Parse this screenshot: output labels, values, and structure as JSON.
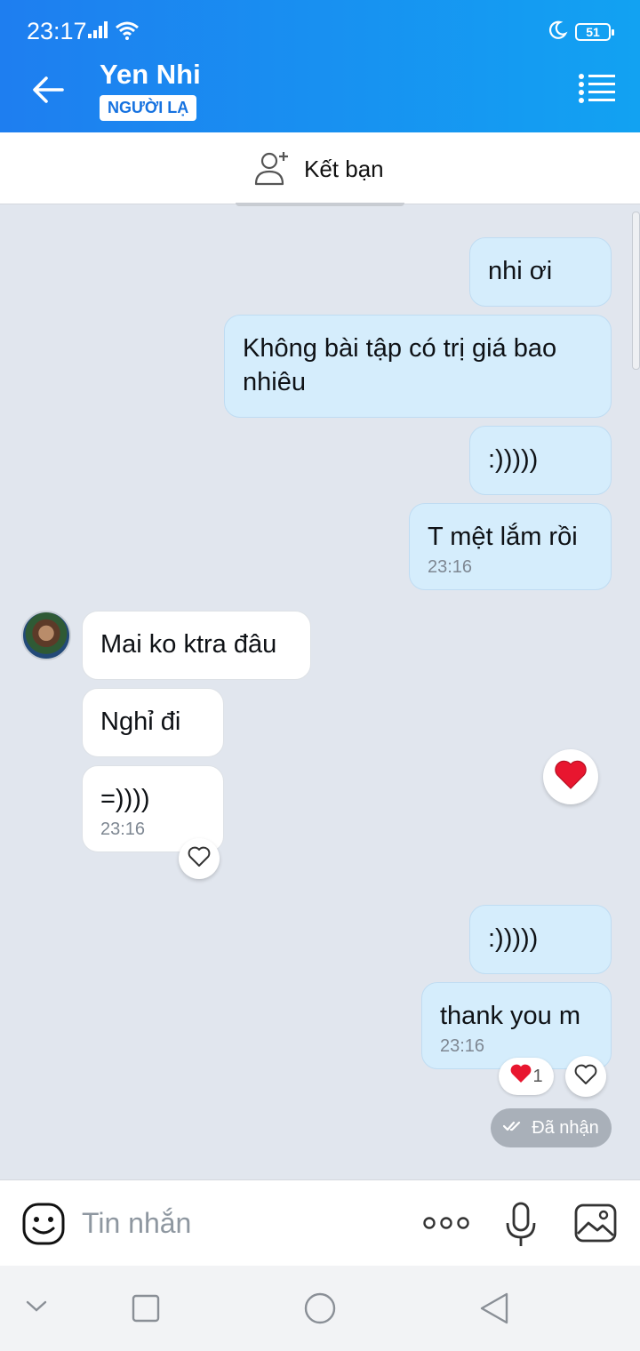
{
  "status_bar": {
    "time": "23:17",
    "battery": "51"
  },
  "header": {
    "title": "Yen Nhi",
    "badge": "NGƯỜI LẠ"
  },
  "add_friend": {
    "label": "Kết bạn"
  },
  "messages": [
    {
      "dir": "out",
      "text": "nhi ơi"
    },
    {
      "dir": "out",
      "text": "Không bài tập có trị giá bao nhiêu"
    },
    {
      "dir": "out",
      "text": ":)))))"
    },
    {
      "dir": "out",
      "text": "T mệt lắm rồi",
      "time": "23:16"
    },
    {
      "dir": "in",
      "text": "Mai ko ktra đâu"
    },
    {
      "dir": "in",
      "text": "Nghỉ đi"
    },
    {
      "dir": "in",
      "text": "=))))",
      "time": "23:16"
    },
    {
      "dir": "out",
      "text": ":)))))"
    },
    {
      "dir": "out",
      "text": "thank you m",
      "time": "23:16"
    }
  ],
  "reaction": {
    "count": "1"
  },
  "delivery": {
    "status": "Đã nhận"
  },
  "composer": {
    "placeholder": "Tin nhắn"
  },
  "colors": {
    "header_start": "#1e7ef0",
    "header_end": "#12a2f2",
    "out_bubble": "#d5edfc",
    "chat_bg": "#e1e6ee",
    "heart": "#e8162f"
  }
}
